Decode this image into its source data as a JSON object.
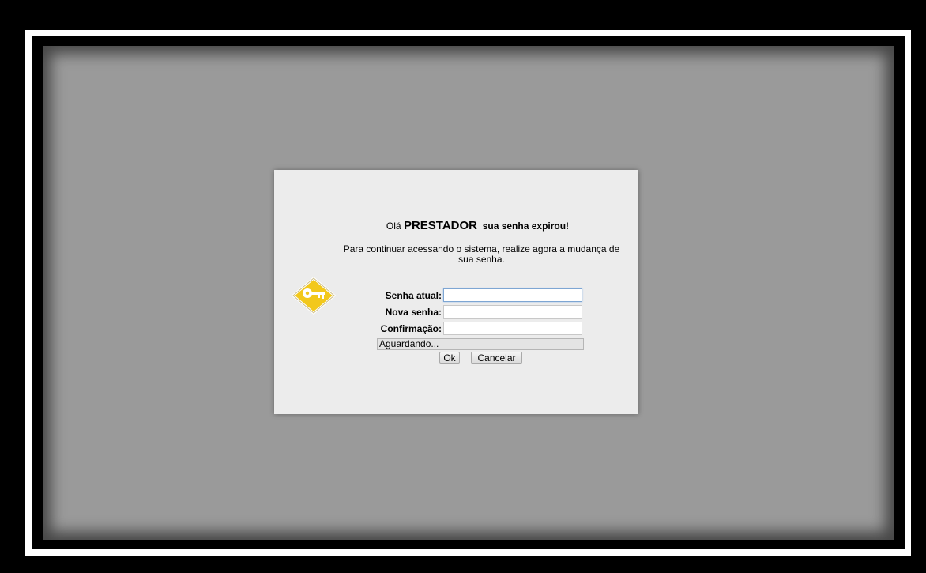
{
  "dialog": {
    "greeting_prefix": "Olá",
    "user_name": "PRESTADOR",
    "greeting_suffix": "sua senha expirou!",
    "instructions": "Para continuar acessando o sistema, realize agora a mudança de sua senha.",
    "key_icon": "key-icon",
    "colors": {
      "backdrop": "#9a9a9a",
      "dialog": "#ececec",
      "icon_yellow": "#f2c81c"
    }
  },
  "form": {
    "current_password_label": "Senha atual:",
    "current_password_value": "",
    "new_password_label": "Nova senha:",
    "new_password_value": "",
    "confirm_label": "Confirmação:",
    "confirm_value": ""
  },
  "status": {
    "text": "Aguardando..."
  },
  "buttons": {
    "ok_label": "Ok",
    "cancel_label": "Cancelar"
  }
}
